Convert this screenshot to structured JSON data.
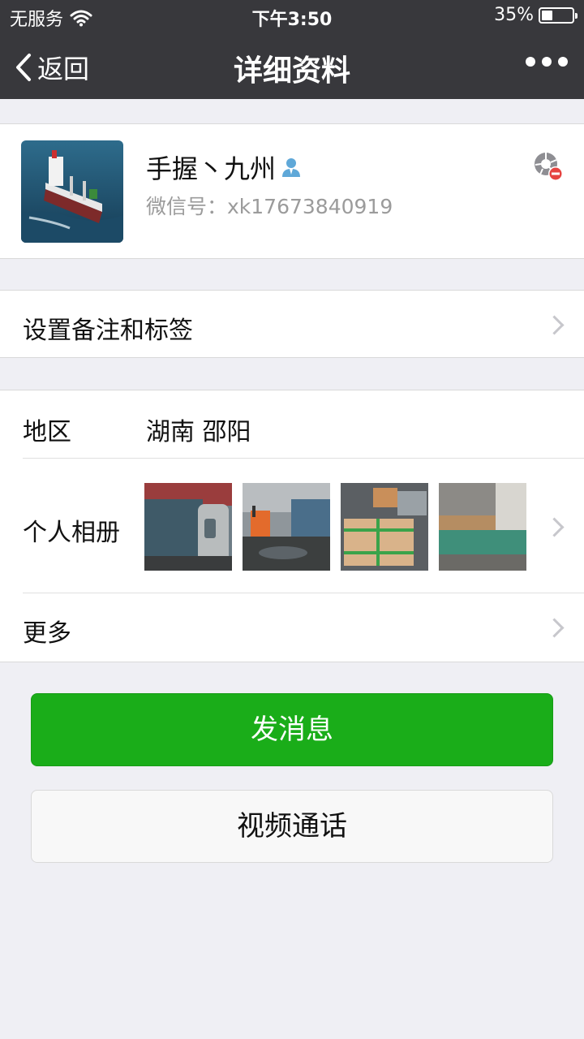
{
  "status_bar": {
    "carrier": "无服务",
    "time": "下午3:50",
    "battery_percent": "35%",
    "battery_level": 0.35
  },
  "nav": {
    "back_label": "返回",
    "title": "详细资料"
  },
  "profile": {
    "name": "手握丶九州",
    "wechat_id": "微信号：xk17673840919"
  },
  "remark_row": {
    "label": "设置备注和标签"
  },
  "info": {
    "region_label": "地区",
    "region_value": "湖南 邵阳",
    "album_label": "个人相册",
    "more_label": "更多"
  },
  "buttons": {
    "send_message": "发消息",
    "video_call": "视频通话"
  },
  "colors": {
    "topbar": "#38383c",
    "accent_green": "#1aad19",
    "background": "#efeff4"
  },
  "icons": [
    "wifi-icon",
    "battery-icon",
    "back-chevron-icon",
    "more-dots-icon",
    "contact-person-icon",
    "moments-blocked-icon",
    "chevron-right-icon"
  ]
}
